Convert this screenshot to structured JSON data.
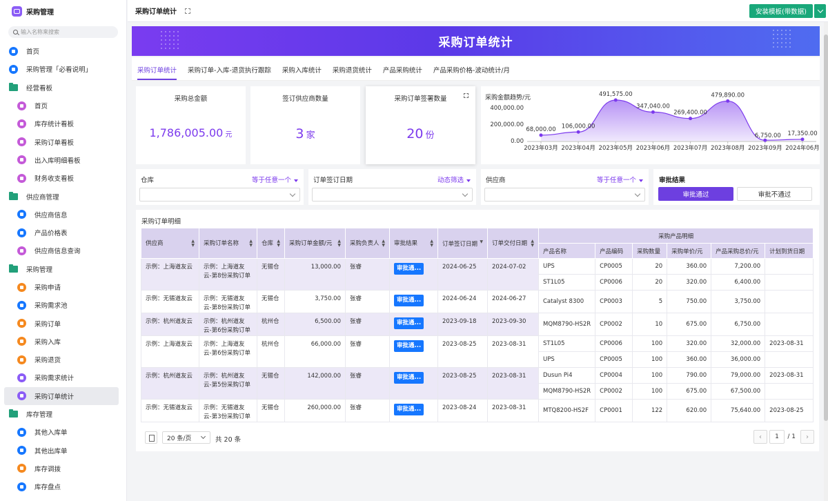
{
  "app": {
    "title": "采购管理"
  },
  "search": {
    "placeholder": "输入名称来搜索"
  },
  "sidebar": {
    "items": [
      {
        "label": "首页",
        "level": 1,
        "icon": "home-icon",
        "color": "#1677ff"
      },
      {
        "label": "采购管理「必看说明」",
        "level": 1,
        "icon": "doc-icon",
        "color": "#1677ff"
      },
      {
        "label": "经营看板",
        "level": 1,
        "icon": "folder-icon",
        "color": "#22a07a"
      },
      {
        "label": "首页",
        "level": 2,
        "icon": "dashboard-icon",
        "color": "#c45ad8"
      },
      {
        "label": "库存统计看板",
        "level": 2,
        "icon": "dashboard-icon",
        "color": "#c45ad8"
      },
      {
        "label": "采购订单看板",
        "level": 2,
        "icon": "dashboard-icon",
        "color": "#c45ad8"
      },
      {
        "label": "出入库明细看板",
        "level": 2,
        "icon": "dashboard-icon",
        "color": "#c45ad8"
      },
      {
        "label": "财务收支看板",
        "level": 2,
        "icon": "dashboard-icon",
        "color": "#c45ad8"
      },
      {
        "label": "供应商管理",
        "level": 1,
        "icon": "folder-icon",
        "color": "#22a07a"
      },
      {
        "label": "供应商信息",
        "level": 2,
        "icon": "user-icon",
        "color": "#1677ff"
      },
      {
        "label": "产品价格表",
        "level": 2,
        "icon": "doc-icon",
        "color": "#1677ff"
      },
      {
        "label": "供应商信息查询",
        "level": 2,
        "icon": "dashboard-icon",
        "color": "#c45ad8"
      },
      {
        "label": "采购管理",
        "level": 1,
        "icon": "folder-icon",
        "color": "#22a07a"
      },
      {
        "label": "采购申请",
        "level": 2,
        "icon": "form-icon",
        "color": "#f5891f"
      },
      {
        "label": "采购需求池",
        "level": 2,
        "icon": "doc-icon",
        "color": "#1677ff"
      },
      {
        "label": "采购订单",
        "level": 2,
        "icon": "form-icon",
        "color": "#f5891f"
      },
      {
        "label": "采购入库",
        "level": 2,
        "icon": "form-icon",
        "color": "#f5891f"
      },
      {
        "label": "采购退货",
        "level": 2,
        "icon": "form-icon",
        "color": "#f5891f"
      },
      {
        "label": "采购需求统计",
        "level": 2,
        "icon": "chart-icon",
        "color": "#8b5cf6"
      },
      {
        "label": "采购订单统计",
        "level": 2,
        "icon": "chart-icon",
        "color": "#8b5cf6",
        "active": true
      },
      {
        "label": "库存管理",
        "level": 1,
        "icon": "folder-icon",
        "color": "#22a07a"
      },
      {
        "label": "其他入库单",
        "level": 2,
        "icon": "doc-icon",
        "color": "#1677ff"
      },
      {
        "label": "其他出库单",
        "level": 2,
        "icon": "doc-icon",
        "color": "#1677ff"
      },
      {
        "label": "库存调拨",
        "level": 2,
        "icon": "form-icon",
        "color": "#f5891f"
      },
      {
        "label": "库存盘点",
        "level": 2,
        "icon": "doc-icon",
        "color": "#1677ff"
      }
    ]
  },
  "topbar": {
    "page_tab": "采购订单统计",
    "install_label": "安装模板(带数据)"
  },
  "banner": {
    "title": "采购订单统计"
  },
  "tabs": [
    {
      "label": "采购订单统计",
      "active": true
    },
    {
      "label": "采购订单-入库-退货执行跟踪"
    },
    {
      "label": "采购入库统计"
    },
    {
      "label": "采购退货统计"
    },
    {
      "label": "产品采购统计"
    },
    {
      "label": "产品采购价格-波动统计/月"
    }
  ],
  "stats": {
    "total_amount": {
      "title": "采购总金额",
      "value": "1,786,005.00",
      "unit": "元"
    },
    "supplier_count": {
      "title": "签订供应商数量",
      "value": "3",
      "unit": "家"
    },
    "order_count": {
      "title": "采购订单签署数量",
      "value": "20",
      "unit": "份"
    }
  },
  "chart_data": {
    "type": "area",
    "title": "采购金额趋势/元",
    "categories": [
      "2023年03月",
      "2023年04月",
      "2023年05月",
      "2023年06月",
      "2023年07月",
      "2023年08月",
      "2023年09月",
      "2024年06月"
    ],
    "values": [
      68000,
      106000,
      491575,
      347040,
      269400,
      479890,
      6750,
      17350
    ],
    "data_labels": [
      "68,000.00",
      "106,000.00",
      "491,575.00",
      "347,040.00",
      "269,400.00",
      "479,890.00",
      "6,750.00",
      "17,350.00"
    ],
    "yticks": [
      "400,000.00",
      "200,000.00",
      "0.00"
    ],
    "ylim": [
      0,
      400000
    ],
    "color": "#7c3aed"
  },
  "filters": {
    "warehouse": {
      "label": "仓库",
      "op": "等于任意一个"
    },
    "sign_date": {
      "label": "订单签订日期",
      "op": "动态筛选"
    },
    "supplier": {
      "label": "供应商",
      "op": "等于任意一个"
    },
    "approval": {
      "label": "审批结果",
      "pass": "审批通过",
      "fail": "审批不通过"
    }
  },
  "table": {
    "caption": "采购订单明细",
    "group_header": "采购产品明细",
    "columns": [
      "供应商",
      "采购订单名称",
      "仓库",
      "采购订单金额/元",
      "采购负责人",
      "审批结果",
      "订单签订日期",
      "订单交付日期"
    ],
    "sub_columns": [
      "产品名称",
      "产品编码",
      "采购数量",
      "采购单价/元",
      "产品采购总价/元",
      "计划到货日期"
    ],
    "rows": [
      {
        "supplier": "示例：上海道友云",
        "name": "示例：上海道友云-第8份采购订单",
        "warehouse": "无锡仓",
        "amount": "13,000.00",
        "owner": "张睿",
        "approval": "审批通...",
        "sign": "2024-06-25",
        "deliver": "2024-07-02",
        "items": [
          {
            "product": "UPS",
            "code": "CP0005",
            "qty": "20",
            "price": "360.00",
            "total": "7,200.00",
            "plan": ""
          },
          {
            "product": "ST1L05",
            "code": "CP0006",
            "qty": "20",
            "price": "320.00",
            "total": "6,400.00",
            "plan": ""
          }
        ]
      },
      {
        "supplier": "示例：无锡道友云",
        "name": "示例：无锡道友云-第8份采购订单",
        "warehouse": "无锡仓",
        "amount": "3,750.00",
        "owner": "张睿",
        "approval": "审批通...",
        "sign": "2024-06-24",
        "deliver": "2024-06-27",
        "items": [
          {
            "product": "Catalyst 8300",
            "code": "CP0003",
            "qty": "5",
            "price": "750.00",
            "total": "3,750.00",
            "plan": ""
          }
        ]
      },
      {
        "supplier": "示例：杭州道友云",
        "name": "示例：杭州道友云-第6份采购订单",
        "warehouse": "杭州仓",
        "amount": "6,500.00",
        "owner": "张睿",
        "approval": "审批通...",
        "sign": "2023-09-18",
        "deliver": "2023-09-30",
        "items": [
          {
            "product": "MQM8790-HS2R",
            "code": "CP0002",
            "qty": "10",
            "price": "675.00",
            "total": "6,750.00",
            "plan": ""
          }
        ]
      },
      {
        "supplier": "示例：上海道友云",
        "name": "示例：上海道友云-第6份采购订单",
        "warehouse": "杭州仓",
        "amount": "66,000.00",
        "owner": "张睿",
        "approval": "审批通...",
        "sign": "2023-08-25",
        "deliver": "2023-08-31",
        "items": [
          {
            "product": "ST1L05",
            "code": "CP0006",
            "qty": "100",
            "price": "320.00",
            "total": "32,000.00",
            "plan": "2023-08-31"
          },
          {
            "product": "UPS",
            "code": "CP0005",
            "qty": "100",
            "price": "360.00",
            "total": "36,000.00",
            "plan": ""
          }
        ]
      },
      {
        "supplier": "示例：杭州道友云",
        "name": "示例：杭州道友云-第5份采购订单",
        "warehouse": "无锡仓",
        "amount": "142,000.00",
        "owner": "张睿",
        "approval": "审批通...",
        "sign": "2023-08-25",
        "deliver": "2023-08-31",
        "items": [
          {
            "product": "Dusun Pi4",
            "code": "CP0004",
            "qty": "100",
            "price": "790.00",
            "total": "79,000.00",
            "plan": "2023-08-31"
          },
          {
            "product": "MQM8790-HS2R",
            "code": "CP0002",
            "qty": "100",
            "price": "675.00",
            "total": "67,500.00",
            "plan": ""
          }
        ]
      },
      {
        "supplier": "示例：无锡道友云",
        "name": "示例：无锡道友云-第3份采购订单",
        "warehouse": "无锡仓",
        "amount": "260,000.00",
        "owner": "张睿",
        "approval": "审批通...",
        "sign": "2023-08-24",
        "deliver": "2023-08-31",
        "items": [
          {
            "product": "MTQ8200-HS2F",
            "code": "CP0001",
            "qty": "122",
            "price": "620.00",
            "total": "75,640.00",
            "plan": "2023-08-25"
          }
        ]
      }
    ]
  },
  "pager": {
    "page_size": "20 条/页",
    "total": "共 20 条",
    "current": "1",
    "of": "/ 1"
  },
  "colors": {
    "accent": "#7c3aed",
    "brand_green": "#19a87a",
    "badge_blue": "#1677ff"
  }
}
